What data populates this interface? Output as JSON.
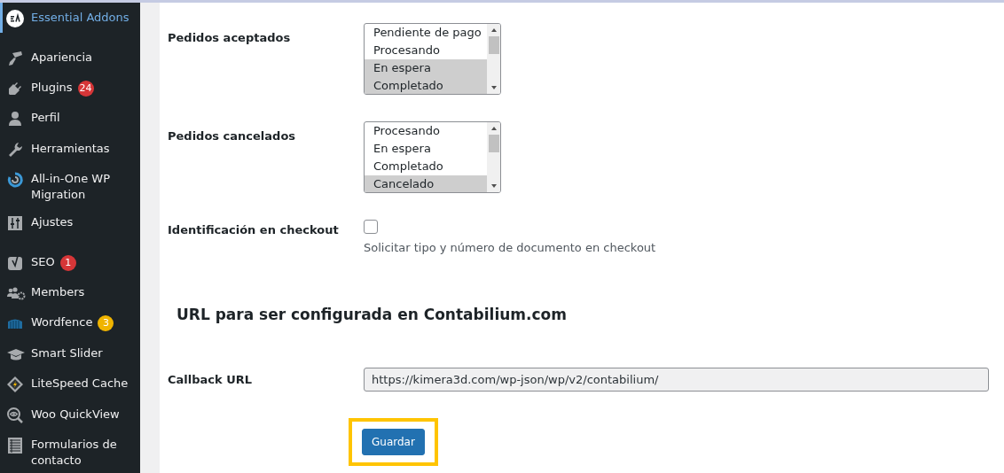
{
  "sidebar": {
    "items": [
      {
        "kind": "item",
        "label": "Essential Addons",
        "selected": true
      },
      {
        "kind": "separator"
      },
      {
        "kind": "item",
        "label": "Apariencia",
        "selected": false
      },
      {
        "kind": "item",
        "label": "Plugins",
        "selected": false,
        "badge": "24",
        "color": "#d63638"
      },
      {
        "kind": "item",
        "label": "Perfil",
        "selected": false
      },
      {
        "kind": "item",
        "label": "Herramientas",
        "selected": false
      },
      {
        "kind": "item",
        "label": "All-in-One WP Migration",
        "selected": false
      },
      {
        "kind": "item",
        "label": "Ajustes",
        "selected": false
      },
      {
        "kind": "separator"
      },
      {
        "kind": "item",
        "label": "SEO",
        "selected": false,
        "badge": "1",
        "color": "#d63638"
      },
      {
        "kind": "item",
        "label": "Members",
        "selected": false
      },
      {
        "kind": "item",
        "label": "Wordfence",
        "selected": false,
        "badge": "3",
        "color": "#f0b400"
      },
      {
        "kind": "item",
        "label": "Smart Slider",
        "selected": false
      },
      {
        "kind": "item",
        "label": "LiteSpeed Cache",
        "selected": false
      },
      {
        "kind": "item",
        "label": "Woo QuickView",
        "selected": false
      },
      {
        "kind": "item",
        "label": "Formularios de contacto",
        "selected": false
      }
    ]
  },
  "settings": [
    {
      "kind": "listbox",
      "label": "Pedidos aceptados",
      "options": [
        {
          "label": "Pendiente de pago",
          "selected": false
        },
        {
          "label": "Procesando",
          "selected": false
        },
        {
          "label": "En espera",
          "selected": true
        },
        {
          "label": "Completado",
          "selected": true
        }
      ]
    },
    {
      "kind": "listbox",
      "label": "Pedidos cancelados",
      "options": [
        {
          "label": "Procesando",
          "selected": false
        },
        {
          "label": "En espera",
          "selected": false
        },
        {
          "label": "Completado",
          "selected": false
        },
        {
          "label": "Cancelado",
          "selected": true
        }
      ]
    },
    {
      "kind": "checkbox",
      "label": "Identificación en checkout",
      "checked": false,
      "description": "Solicitar tipo y número de documento en checkout"
    }
  ],
  "section_heading": "URL para ser configurada en Contabilium.com",
  "callback": {
    "label": "Callback URL",
    "value": "https://kimera3d.com/wp-json/wp/v2/contabilium/"
  },
  "save_button": {
    "label": "Guardar",
    "highlighted": true
  }
}
